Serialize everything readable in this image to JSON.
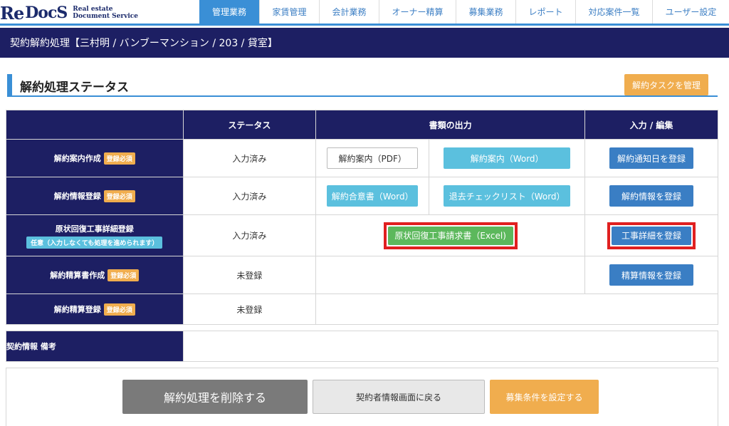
{
  "brand": {
    "logo_re": "Re",
    "logo_docs": "DocS",
    "sub_line1": "Real estate",
    "sub_line2": "Document Service"
  },
  "nav": [
    "管理業務",
    "家賃管理",
    "会計業務",
    "オーナー精算",
    "募集業務",
    "レポート",
    "対応案件一覧",
    "ユーザー設定"
  ],
  "page_title": "契約解約処理【三村明 / バンブーマンション / 203 / 貸室】",
  "section": {
    "title": "解約処理ステータス",
    "manage_button": "解約タスクを管理"
  },
  "table": {
    "headers": [
      "",
      "ステータス",
      "書類の出力",
      "入力 / 編集"
    ],
    "rows": [
      {
        "label": "解約案内作成",
        "badge": "登録必須",
        "status": "入力済み",
        "doc1": "解約案内（PDF）",
        "doc2": "解約案内（Word）",
        "action": "解約通知日を登録"
      },
      {
        "label": "解約情報登録",
        "badge": "登録必須",
        "status": "入力済み",
        "doc1": "解約合意書（Word）",
        "doc2": "退去チェックリスト（Word）",
        "action": "解約情報を登録"
      },
      {
        "label": "原状回復工事詳細登録",
        "badge": "任意（入力しなくても処理を進められます）",
        "status": "入力済み",
        "doc1": "原状回復工事請求書（Excel)",
        "action": "工事詳細を登録"
      },
      {
        "label": "解約精算書作成",
        "badge": "登録必須",
        "status": "未登録",
        "action": "精算情報を登録"
      },
      {
        "label": "解約精算登録",
        "badge": "登録必須",
        "status": "未登録"
      }
    ]
  },
  "memo_label": "契約情報 備考",
  "bottom": {
    "delete": "解約処理を削除する",
    "back": "契約者情報画面に戻る",
    "recruit": "募集条件を設定する"
  }
}
